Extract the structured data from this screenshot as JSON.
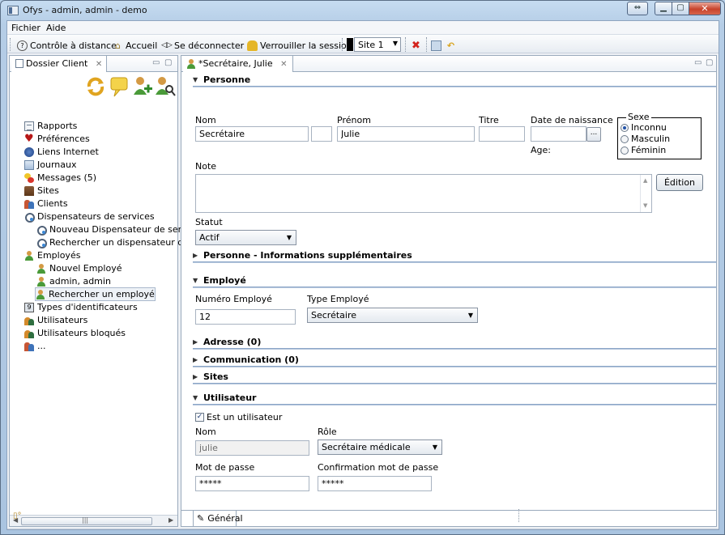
{
  "window": {
    "title": "Ofys - admin, admin - demo"
  },
  "menu": [
    "Fichier",
    "Aide"
  ],
  "toolbar": {
    "remote": "Contrôle à distance",
    "home": "Accueil",
    "logout": "Se déconnecter",
    "lock": "Verrouiller la session",
    "site": "Site 1"
  },
  "left_view": {
    "tab": "Dossier Client",
    "tree": [
      {
        "label": "Rapports",
        "icon": "rapports-icon",
        "indent": 0
      },
      {
        "label": "Préférences",
        "icon": "heart-icon",
        "indent": 0
      },
      {
        "label": "Liens Internet",
        "icon": "globe-icon",
        "indent": 0
      },
      {
        "label": "Journaux",
        "icon": "journal-icon",
        "indent": 0
      },
      {
        "label": "Messages (5)",
        "icon": "messages-icon",
        "indent": 0
      },
      {
        "label": "Sites",
        "icon": "sites-icon",
        "indent": 0
      },
      {
        "label": "Clients",
        "icon": "clients-icon",
        "indent": 0
      },
      {
        "label": "Dispensateurs de services",
        "icon": "stethoscope-icon",
        "indent": 0
      },
      {
        "label": "Nouveau Dispensateur de servic",
        "icon": "stethoscope-add-icon",
        "indent": 1
      },
      {
        "label": "Rechercher un dispensateur de s",
        "icon": "stethoscope-search-icon",
        "indent": 1
      },
      {
        "label": "Employés",
        "icon": "employee-icon",
        "indent": 0
      },
      {
        "label": "Nouvel Employé",
        "icon": "employee-add-icon",
        "indent": 1
      },
      {
        "label": "admin, admin",
        "icon": "employee-icon",
        "indent": 1
      },
      {
        "label": "Rechercher un employé",
        "icon": "employee-search-icon",
        "indent": 1
      },
      {
        "label": "Types d'identificateurs",
        "icon": "identifier-icon",
        "indent": 0
      },
      {
        "label": "Utilisateurs",
        "icon": "users-icon",
        "indent": 0
      },
      {
        "label": "Utilisateurs bloqués",
        "icon": "users-blocked-icon",
        "indent": 0
      },
      {
        "label": "...",
        "icon": "clients-icon",
        "indent": 0
      }
    ],
    "selected_index": 13
  },
  "editor": {
    "tab": "*Secrétaire, Julie",
    "sections": {
      "personne": "Personne",
      "personne_info": "Personne - Informations supplémentaires",
      "employe": "Employé",
      "adresse": "Adresse (0)",
      "communication": "Communication (0)",
      "sites": "Sites",
      "utilisateur": "Utilisateur"
    },
    "personne": {
      "nom_label": "Nom",
      "nom_value": "Secrétaire",
      "prenom_label": "Prénom",
      "prenom_value": "Julie",
      "titre_label": "Titre",
      "titre_value": "",
      "dob_label": "Date de naissance",
      "dob_value": "",
      "dob_button": "...",
      "age_label": "Age:",
      "sexe_label": "Sexe",
      "sexe_options": [
        "Inconnu",
        "Masculin",
        "Féminin"
      ],
      "sexe_selected": 0,
      "note_label": "Note",
      "edition_button": "Édition",
      "statut_label": "Statut",
      "statut_value": "Actif"
    },
    "employe": {
      "numero_label": "Numéro Employé",
      "numero_value": "12",
      "type_label": "Type Employé",
      "type_value": "Secrétaire"
    },
    "utilisateur": {
      "est_utilisateur": "Est un utilisateur",
      "checked": true,
      "nom_label": "Nom",
      "nom_value": "julie",
      "role_label": "Rôle",
      "role_value": "Secrétaire médicale",
      "mdp_label": "Mot de passe",
      "mdp_value": "*****",
      "confirm_label": "Confirmation mot de passe",
      "confirm_value": "*****"
    },
    "bottom_tab": "Général"
  }
}
